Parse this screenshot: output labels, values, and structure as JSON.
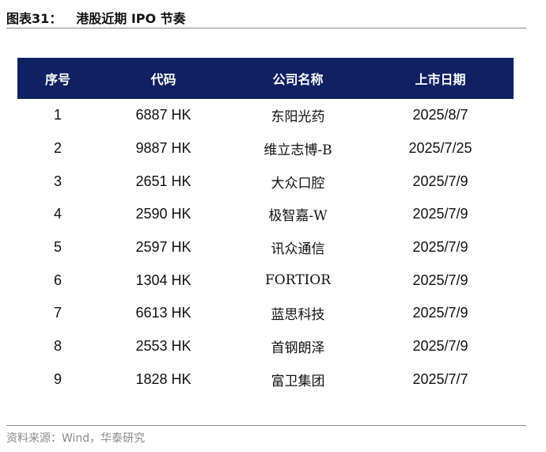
{
  "figure": {
    "label": "图表31：",
    "title": "港股近期 IPO 节奏"
  },
  "table": {
    "headers": [
      "序号",
      "代码",
      "公司名称",
      "上市日期"
    ],
    "rows": [
      {
        "seq": "1",
        "code": "6887 HK",
        "name": "东阳光药",
        "date": "2025/8/7"
      },
      {
        "seq": "2",
        "code": "9887 HK",
        "name": "维立志博-B",
        "date": "2025/7/25"
      },
      {
        "seq": "3",
        "code": "2651 HK",
        "name": "大众口腔",
        "date": "2025/7/9"
      },
      {
        "seq": "4",
        "code": "2590 HK",
        "name": "极智嘉-W",
        "date": "2025/7/9"
      },
      {
        "seq": "5",
        "code": "2597 HK",
        "name": "讯众通信",
        "date": "2025/7/9"
      },
      {
        "seq": "6",
        "code": "1304 HK",
        "name": "FORTIOR",
        "date": "2025/7/9"
      },
      {
        "seq": "7",
        "code": "6613 HK",
        "name": "蓝思科技",
        "date": "2025/7/9"
      },
      {
        "seq": "8",
        "code": "2553 HK",
        "name": "首钢朗泽",
        "date": "2025/7/9"
      },
      {
        "seq": "9",
        "code": "1828 HK",
        "name": "富卫集团",
        "date": "2025/7/7"
      }
    ]
  },
  "source": "资料来源：Wind，华泰研究",
  "colors": {
    "header_background": "#0f2161",
    "header_text": "#ffffff",
    "rule": "#8c8c8c",
    "source_text": "#8a8a8a"
  }
}
